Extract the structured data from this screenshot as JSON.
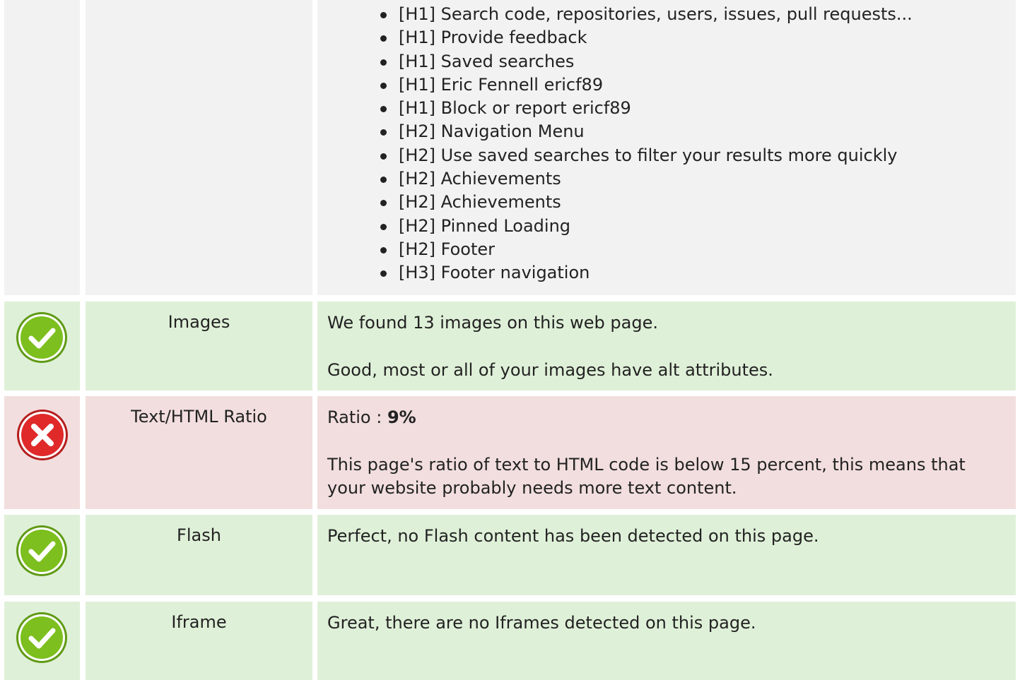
{
  "headings": [
    "[H1] Search code, repositories, users, issues, pull requests...",
    "[H1] Provide feedback",
    "[H1] Saved searches",
    "[H1] Eric Fennell ericf89",
    "[H1] Block or report ericf89",
    "[H2] Navigation Menu",
    "[H2] Use saved searches to filter your results more quickly",
    "[H2] Achievements",
    "[H2] Achievements",
    "[H2] Pinned Loading",
    "[H2] Footer",
    "[H3] Footer navigation"
  ],
  "rows": {
    "images": {
      "status": "pass",
      "label": "Images",
      "line1": "We found 13 images on this web page.",
      "line2": "Good, most or all of your images have alt attributes."
    },
    "ratio": {
      "status": "fail",
      "label": "Text/HTML Ratio",
      "prefix": "Ratio : ",
      "value": "9%",
      "line2": "This page's ratio of text to HTML code is below 15 percent, this means that your website probably needs more text content."
    },
    "flash": {
      "status": "pass",
      "label": "Flash",
      "line1": "Perfect, no Flash content has been detected on this page."
    },
    "iframe": {
      "status": "pass",
      "label": "Iframe",
      "line1": "Great, there are no Iframes detected on this page."
    }
  },
  "colors": {
    "pass_bg": "#dff0d8",
    "fail_bg": "#f2dede",
    "neutral_bg": "#f2f2f2",
    "pass_icon": "#7cbf1e",
    "fail_icon": "#e02a2a"
  }
}
